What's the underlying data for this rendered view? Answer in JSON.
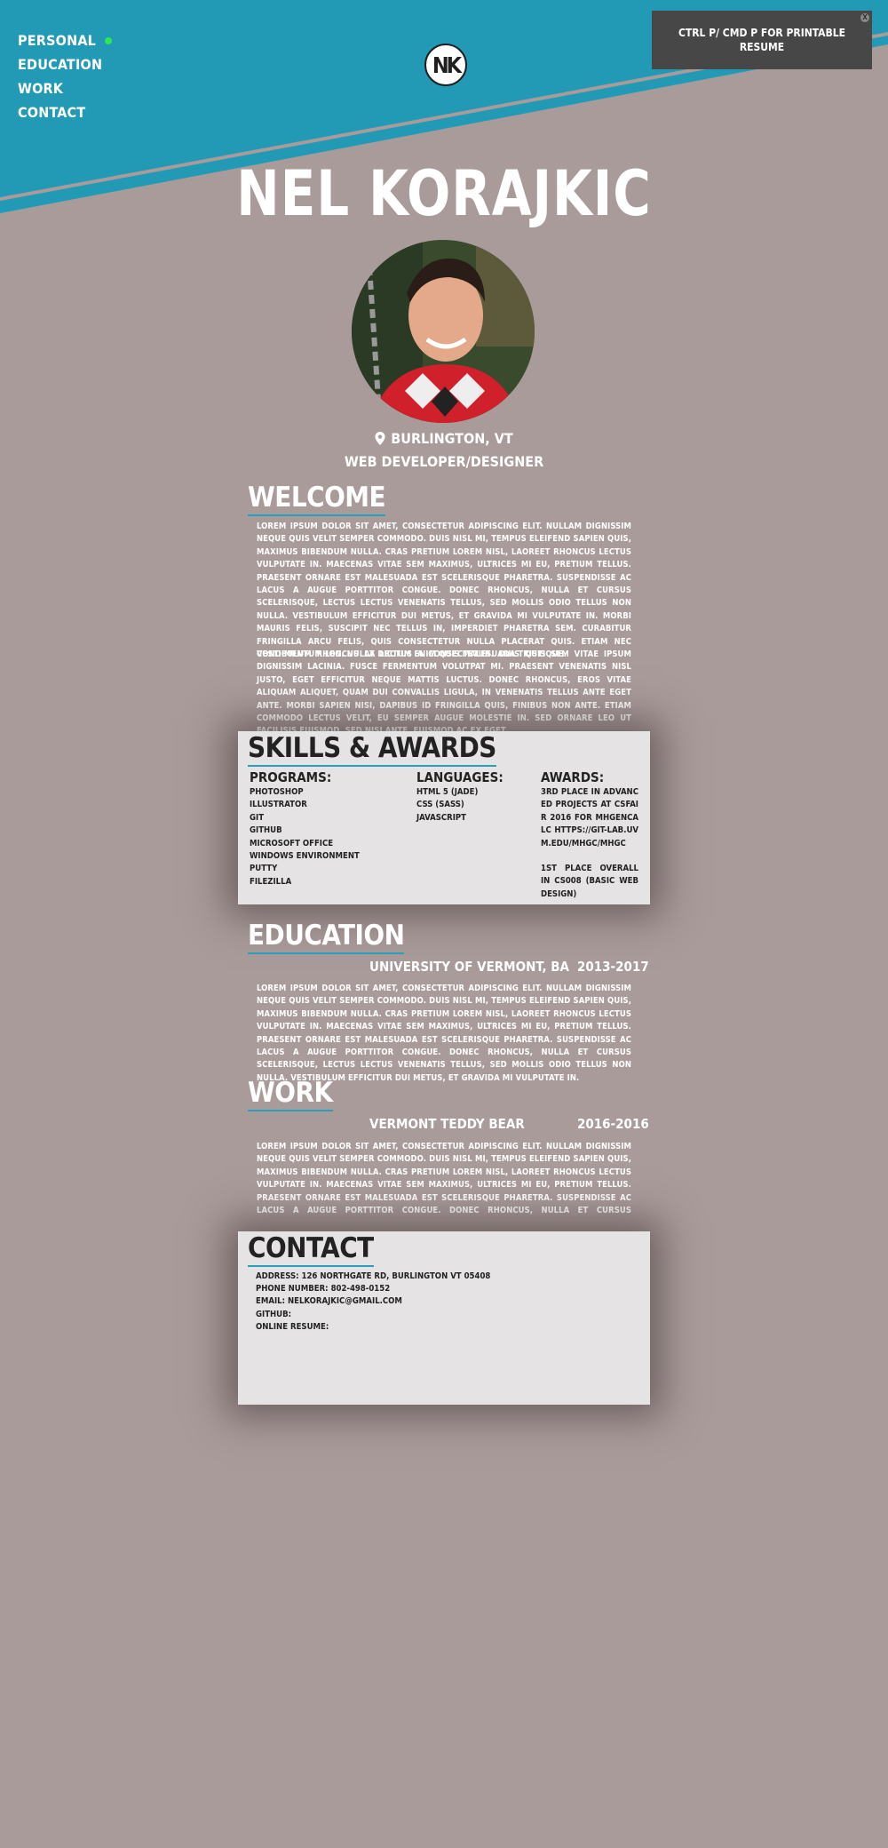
{
  "nav": {
    "items": [
      "PERSONAL",
      "EDUCATION",
      "WORK",
      "CONTACT"
    ],
    "active_index": 0
  },
  "logo": {
    "text": "NK"
  },
  "print_notice": {
    "text": "CTRL P/ CMD P FOR PRINTABLE RESUME",
    "close": "x"
  },
  "profile": {
    "name": "NEL KORAJKIC",
    "location": "BURLINGTON, VT",
    "role": "WEB DEVELOPER/DESIGNER"
  },
  "welcome": {
    "title": "WELCOME",
    "paragraphs": [
      "Lorem ipsum dolor sit amet, consectetur adipiscing elit. Nullam dignissim neque quis velit semper commodo. Duis nisl mi, tempus eleifend sapien quis, maximus bibendum nulla. Cras pretium lorem nisl, laoreet rhoncus lectus vulputate in. Maecenas vitae sem maximus, ultrices mi eu, pretium tellus. Praesent ornare est malesuada est scelerisque pharetra. Suspendisse ac lacus a augue porttitor congue. Donec rhoncus, nulla et cursus scelerisque, lectus lectus venenatis tellus, sed mollis odio tellus non nulla. Vestibulum efficitur dui metus, et gravida mi vulputate in. Morbi mauris felis, suscipit nec tellus in, imperdiet pharetra sem. Curabitur fringilla arcu felis, quis consectetur nulla placerat quis. Etiam nec condimentum leo. Nulla dictum enim quis malesuada tristique.",
      "Vestibulum rhoncus at lectus a consectetur. Duis quis sem vitae ipsum dignissim lacinia. Fusce fermentum volutpat mi. Praesent venenatis nisl justo, eget efficitur neque mattis luctus. Donec rhoncus, eros vitae aliquam aliquet, quam dui convallis ligula, in venenatis tellus ante eget ante. Morbi sapien nisi, dapibus id fringilla quis, finibus non ante. Etiam commodo lectus velit, eu semper augue molestie in. Sed ornare leo ut facilisis euismod. Sed nisi ante, euismod ac ex eget."
    ]
  },
  "skills": {
    "title": "SKILLS & AWARDS",
    "programs_label": "PROGRAMS:",
    "programs": [
      "PHOTOSHOP",
      "ILLUSTRATOR",
      "GIT",
      "GITHUB",
      "MICROSOFT OFFICE",
      "WINDOWS ENVIRONMENT",
      "PUTTY",
      "FILEZILLA"
    ],
    "languages_label": "LANGUAGES:",
    "languages": [
      "HTML 5 (JADE)",
      "CSS (SASS)",
      "JAVASCRIPT"
    ],
    "awards_label": "AWARDS:",
    "awards": [
      "3RD PLACE IN ADVANCED PROJECTS AT CSFAIR 2016 FOR MHGENCALC HTTPS://GIT-LAB.UVM.EDU/MHGC/MHGC",
      "1ST PLACE OVERALL IN CS008 (BASIC WEB DESIGN)"
    ]
  },
  "education": {
    "title": "EDUCATION",
    "school": "UNIVERSITY OF VERMONT, BA",
    "years": "2013-2017",
    "text": "Lorem ipsum dolor sit amet, consectetur adipiscing elit. Nullam dignissim neque quis velit semper commodo. Duis nisl mi, tempus eleifend sapien quis, maximus bibendum nulla. Cras pretium lorem nisl, laoreet rhoncus lectus vulputate in. Maecenas vitae sem maximus, ultrices mi eu, pretium tellus. Praesent ornare est malesuada est scelerisque pharetra. Suspendisse ac lacus a augue porttitor congue. Donec rhoncus, nulla et cursus scelerisque, lectus lectus venenatis tellus, sed mollis odio tellus non nulla. Vestibulum efficitur dui metus, et gravida mi vulputate in."
  },
  "work": {
    "title": "WORK",
    "employer": "VERMONT TEDDY BEAR",
    "years": "2016-2016",
    "text": "Lorem ipsum dolor sit amet, consectetur adipiscing elit. Nullam dignissim neque quis velit semper commodo. Duis nisl mi, tempus eleifend sapien quis, maximus bibendum nulla. Cras pretium lorem nisl, laoreet rhoncus lectus vulputate in. Maecenas vitae sem maximus, ultrices mi eu, pretium tellus. Praesent ornare est malesuada est scelerisque pharetra. Suspendisse ac lacus a augue porttitor congue. Donec rhoncus, nulla et cursus scelerisque, lectus lectus venenatis tellus, sed mollis odio tellus non nulla. Vestibulum efficitur dui metus, et gravida mi vulputate in. Morbi"
  },
  "contact": {
    "title": "CONTACT",
    "address": "ADDRESS: 126 NORTHGATE RD, BURLINGTON VT 05408",
    "phone": "PHONE NUMBER: 802-498-0152",
    "email": "EMAIL: NELKORAJKIC@GMAIL.COM",
    "github": "GITHUB:",
    "resume": "ONLINE RESUME:"
  },
  "colors": {
    "background": "#a99b9a",
    "banner": "#229ab6",
    "accent": "#27a0bd",
    "card": "#e5e3e4",
    "active_dot": "#2ee84d"
  }
}
